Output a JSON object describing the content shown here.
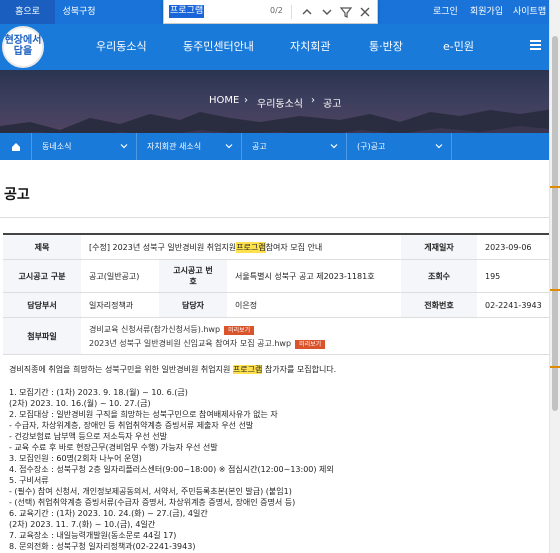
{
  "topbar": {
    "home_tab": "홈으로",
    "gu_tab": "성북구청",
    "login": "로그인",
    "join": "회원가입",
    "sitemap": "사이트맵"
  },
  "findbar": {
    "query": "프로그램",
    "count": "0/2"
  },
  "header": {
    "logo_text": "현장에서답을",
    "nav": [
      "우리동소식",
      "동주민센터안내",
      "자치회관",
      "통·반장",
      "e-민원"
    ]
  },
  "breadcrumb": [
    "HOME",
    "우리동소식",
    "공고"
  ],
  "subnav": [
    "동네소식",
    "자치회관 새소식",
    "공고",
    "(구)공고"
  ],
  "page_title": "공고",
  "table": {
    "row1": {
      "h1": "제목",
      "title_prefix": "[수정] 2023년 성북구 일반경비원 취업지원 ",
      "title_hl": "프로그램",
      "title_suffix": " 참여자 모집 안내",
      "h2": "게재일자",
      "date": "2023-09-06"
    },
    "row2": {
      "h1": "고시공고 구분",
      "type": "공고(일반공고)",
      "h2": "고시공고 번호",
      "number": "서울특별시 성북구 공고 제2023-1181호",
      "h3": "조회수",
      "views": "195"
    },
    "row3": {
      "h1": "담당부서",
      "dept": "일자리정책과",
      "h2": "담당자",
      "person": "이은정",
      "h3": "전화번호",
      "phone": "02-2241-3943"
    },
    "row4": {
      "h1": "첨부파일",
      "file1": "경비교육 신청서류(참가신청서등).hwp",
      "file2": "2023년 성북구 일반경비원 신임교육 참여자 모집 공고.hwp",
      "download": "미리보기"
    }
  },
  "body": {
    "intro_prefix": "경비직종에 취업을 희망하는 성북구민을 위한 일반경비원 취업지원 ",
    "intro_hl": "프로그램",
    "intro_suffix": " 참가자를 모집합니다.",
    "lines": [
      "1. 모집기간 : (1차) 2023. 9. 18.(월) ~ 10. 6.(금)",
      "(2차) 2023. 10. 16.(월) ~ 10. 27.(금)",
      "2. 모집대상 : 일반경비원 구직을 희망하는 성북구민으로 참여배제사유가 없는 자",
      "- 수급자, 차상위계층, 장애인 등 취업취약계층 증빙서류 제출자 우선 선발",
      "- 건강보험료 납부액 등으로 저소득자 우선 선발",
      "- 교육 수료 후 바로 현장근무(경비업무 수행) 가능자 우선 선발",
      "3. 모집인원 : 60명(2회차 나누어 운영)",
      "4. 접수장소 : 성북구청 2층 일자리플러스센터(9:00~18:00) ※ 점심시간(12:00~13:00) 제외",
      "5. 구비서류",
      "- (필수) 참여 신청서, 개인정보제공동의서, 서약서, 주민등록초본(본인 발급) (붙임1)",
      "- (선택) 취업취약계층 증빙서류(수급자 증명서, 차상위계층 증명서, 장애인 증명서 등)",
      "6. 교육기간 : (1차) 2023. 10. 24.(화) ~ 27.(금), 4일간",
      "(2차) 2023. 11. 7.(화) ~ 10.(금), 4일간",
      "7. 교육장소 : 내일능력개발원(동소문로 44길 17)",
      "8. 문의전화 : 성북구청 일자리정책과(02-2241-3943)"
    ]
  },
  "colors": {
    "primary": "#1a7ad9",
    "highlight": "#ffe14d",
    "download_button": "#d9532b"
  }
}
